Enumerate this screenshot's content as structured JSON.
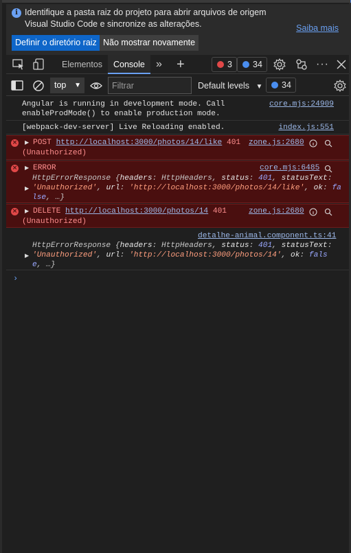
{
  "infobar": {
    "message": "Identifique a pasta raiz do projeto para abrir arquivos de origem Visual Studio Code e sincronize as alterações.",
    "learn_more": "Saiba mais",
    "set_root_button": "Definir o diretório raiz",
    "dont_show_button": "Não mostrar novamente"
  },
  "tabs": {
    "elements": "Elementos",
    "console": "Console",
    "error_count": "3",
    "info_count": "34"
  },
  "filter": {
    "context": "top",
    "placeholder": "Filtrar",
    "levels": "Default levels",
    "info_count": "34"
  },
  "console": {
    "msg1": {
      "line1": "Angular is running in development mode. Call",
      "line2": "enableProdMode() to enable production mode.",
      "source": "core.mjs:24909"
    },
    "msg2": {
      "text": "[webpack-dev-server] Live Reloading enabled.",
      "source": "index.js:551"
    },
    "msg3": {
      "method": "POST",
      "url": "http://localhost:3000/photos/14/like",
      "status": "401",
      "status_text": "(Unauthorized)",
      "source": "zone.js:2680"
    },
    "msg4": {
      "title": "ERROR",
      "source": "core.mjs:6485",
      "l1_a": "HttpErrorResponse {",
      "l1_k1": "headers",
      "l1_b": ": HttpHeaders, ",
      "l1_k2": "status",
      "l1_c": ": ",
      "l1_v": "401",
      "l1_d": ", ",
      "l1_k3": "statusText",
      "l1_e": ":",
      "l2_s": "'Unauthorized'",
      "l2_a": ", ",
      "l2_k": "url",
      "l2_b": ": ",
      "l2_u": "'http://localhost:3000/photos/14/like'",
      "l2_c": ", ",
      "l2_k2": "ok",
      "l2_d": ": ",
      "l2_v": "fa",
      "l3_v": "lse",
      "l3_e": ", …}"
    },
    "msg5": {
      "method": "DELETE",
      "url": "http://localhost:3000/photos/14",
      "status": "401",
      "status_text": "(Unauthorized)",
      "source": "zone.js:2680"
    },
    "msg6": {
      "source": "detalhe-animal.component.ts:41",
      "l1_a": "HttpErrorResponse {",
      "l1_k1": "headers",
      "l1_b": ": HttpHeaders, ",
      "l1_k2": "status",
      "l1_c": ": ",
      "l1_v": "401",
      "l1_d": ", ",
      "l1_k3": "statusText",
      "l1_e": ":",
      "l2_s": "'Unauthorized'",
      "l2_a": ", ",
      "l2_k": "url",
      "l2_b": ": ",
      "l2_u": "'http://localhost:3000/photos/14'",
      "l2_c": ", ",
      "l2_k2": "ok",
      "l2_d": ": ",
      "l2_v": "fals",
      "l3_v": "e",
      "l3_e": ", …}"
    },
    "prompt": "›"
  },
  "colors": {
    "accent": "#6aa0f2",
    "primary_button": "#0e66c9",
    "error_bg": "#4a0f0f",
    "error_text": "#ff8f8f"
  }
}
